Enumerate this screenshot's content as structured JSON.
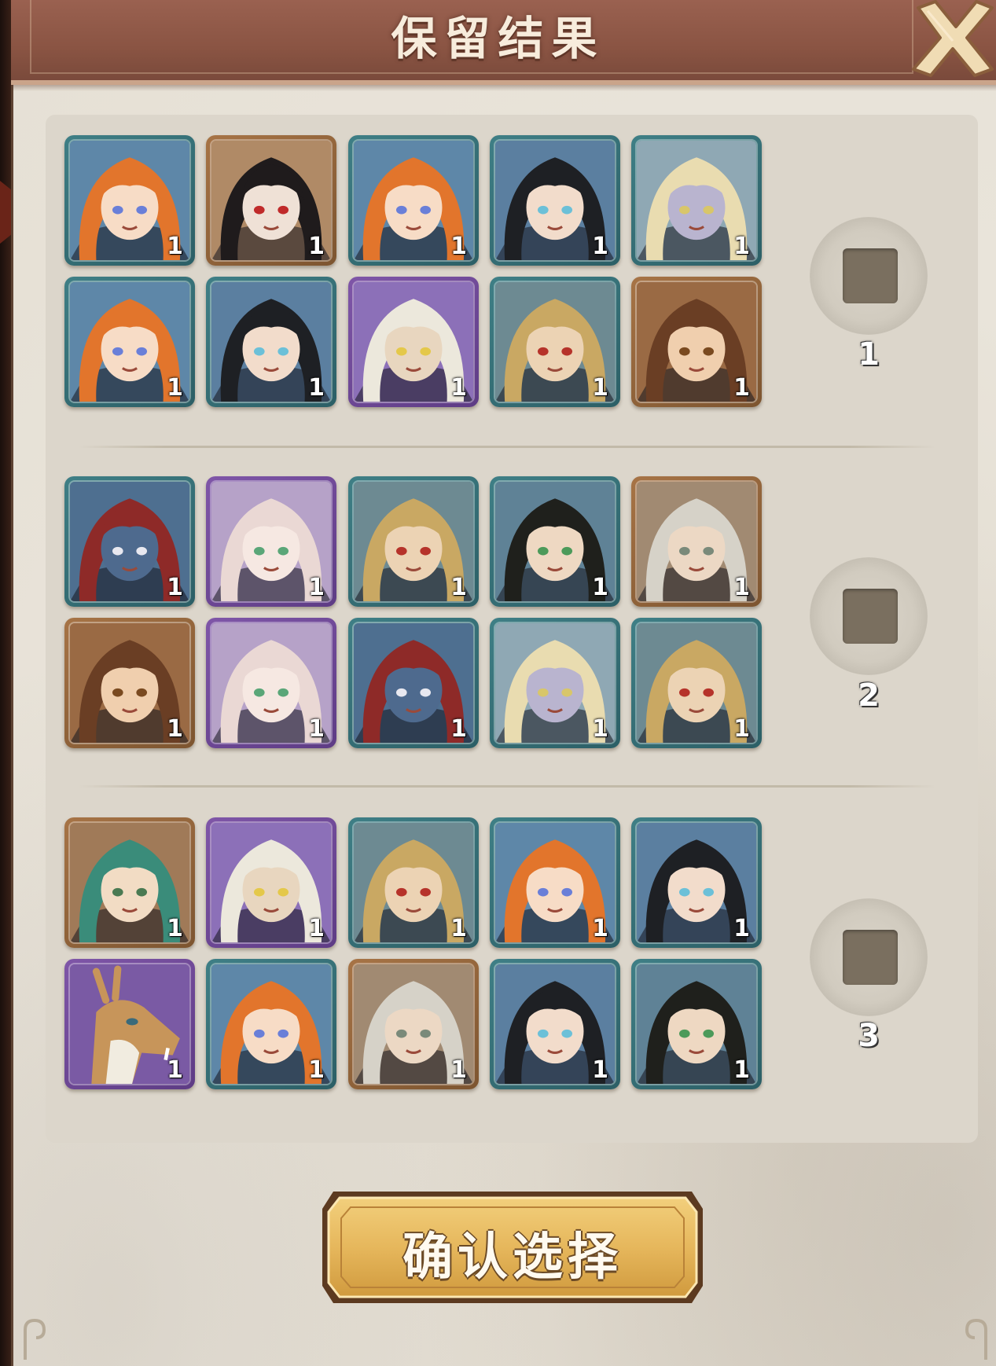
{
  "header": {
    "title": "保留结果"
  },
  "groups": [
    {
      "label": "1",
      "selected": false,
      "cards": [
        {
          "character": "orange-haired-girl",
          "rarity": "teal",
          "count": "1"
        },
        {
          "character": "black-haired-woman-red-eyes",
          "rarity": "orange",
          "count": "1"
        },
        {
          "character": "orange-haired-girl",
          "rarity": "teal",
          "count": "1"
        },
        {
          "character": "black-haired-youth",
          "rarity": "teal",
          "count": "1"
        },
        {
          "character": "blonde-pale-woman",
          "rarity": "teal",
          "count": "1"
        },
        {
          "character": "orange-haired-girl",
          "rarity": "teal",
          "count": "1"
        },
        {
          "character": "black-haired-youth",
          "rarity": "teal",
          "count": "1"
        },
        {
          "character": "white-haired-man",
          "rarity": "purple",
          "count": "1"
        },
        {
          "character": "blonde-man-red-mark",
          "rarity": "teal",
          "count": "1"
        },
        {
          "character": "brown-haired-boy",
          "rarity": "orange",
          "count": "1"
        }
      ]
    },
    {
      "label": "2",
      "selected": false,
      "cards": [
        {
          "character": "blue-skinned-bearded-warrior",
          "rarity": "teal",
          "count": "1"
        },
        {
          "character": "pink-haired-girl",
          "rarity": "purple",
          "count": "1"
        },
        {
          "character": "blonde-man-red-mark",
          "rarity": "teal",
          "count": "1"
        },
        {
          "character": "black-haired-man-headband",
          "rarity": "teal",
          "count": "1"
        },
        {
          "character": "silver-haired-man",
          "rarity": "orange",
          "count": "1"
        },
        {
          "character": "brown-haired-boy",
          "rarity": "orange",
          "count": "1"
        },
        {
          "character": "pink-haired-girl",
          "rarity": "purple",
          "count": "1"
        },
        {
          "character": "blue-skinned-bearded-warrior",
          "rarity": "teal",
          "count": "1"
        },
        {
          "character": "blonde-pale-woman",
          "rarity": "teal",
          "count": "1"
        },
        {
          "character": "blonde-man-red-mark",
          "rarity": "teal",
          "count": "1"
        }
      ]
    },
    {
      "label": "3",
      "selected": false,
      "cards": [
        {
          "character": "green-haired-woman-flowers",
          "rarity": "orange",
          "count": "1"
        },
        {
          "character": "white-haired-man",
          "rarity": "purple",
          "count": "1"
        },
        {
          "character": "blonde-man-red-mark",
          "rarity": "teal",
          "count": "1"
        },
        {
          "character": "orange-haired-girl",
          "rarity": "teal",
          "count": "1"
        },
        {
          "character": "black-haired-youth",
          "rarity": "teal",
          "count": "1"
        },
        {
          "character": "deer-creature",
          "rarity": "purple",
          "count": "1"
        },
        {
          "character": "orange-haired-girl",
          "rarity": "teal",
          "count": "1"
        },
        {
          "character": "silver-haired-man",
          "rarity": "orange",
          "count": "1"
        },
        {
          "character": "black-haired-youth",
          "rarity": "teal",
          "count": "1"
        },
        {
          "character": "black-haired-man-headband",
          "rarity": "teal",
          "count": "1"
        }
      ]
    }
  ],
  "confirm_button": {
    "label": "确认选择"
  },
  "icons": {
    "close": "close-x-icon",
    "select": "checkbox-icon"
  },
  "colors": {
    "header": "#8a5443",
    "panel": "#e6e0d5",
    "rarity_teal": "#3f7f86",
    "rarity_orange": "#a77446",
    "rarity_purple": "#7f56a8",
    "button_gold": "#e6b75c"
  }
}
